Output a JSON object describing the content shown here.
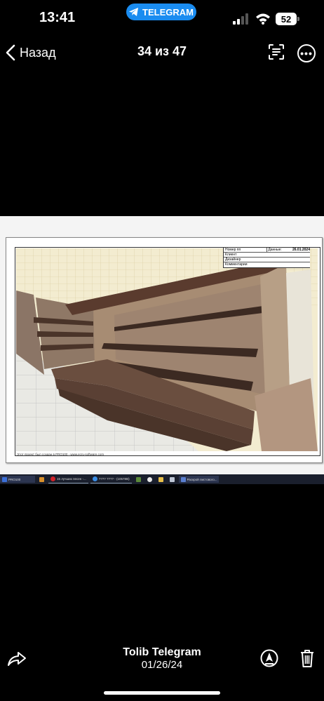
{
  "status_bar": {
    "time": "13:41",
    "telegram_label": "TELEGRAM",
    "battery": "52"
  },
  "nav": {
    "back_label": "Назад",
    "counter": "34 из 47"
  },
  "photo": {
    "title_block": {
      "number_label": "Номер пп",
      "date_label": "Данные:",
      "date_value": "26.01.2024",
      "client_label": "Клиент",
      "designer_label": "Дизайнер",
      "comments_label": "Комментарии"
    },
    "footer_note": "Этот проект был создан в PRO100 - www.ecru-software.com",
    "taskbar": [
      {
        "label": "PRO100",
        "icon": "pro100-icon"
      },
      {
        "label": "",
        "icon": "pdf-icon"
      },
      {
        "label": "15 лучших песен -...",
        "icon": "opera-icon"
      },
      {
        "label": "???? ???? - (10578B)",
        "icon": "chrome-icon"
      },
      {
        "label": "",
        "icon": "minecraft-icon"
      },
      {
        "label": "",
        "icon": "settings-icon"
      },
      {
        "label": "",
        "icon": "folder-icon"
      },
      {
        "label": "",
        "icon": "app-icon"
      },
      {
        "label": "Раскрой листового...",
        "icon": "app-window-icon"
      }
    ]
  },
  "footer": {
    "sender": "Tolib Telegram",
    "date": "01/26/24"
  },
  "colors": {
    "accent": "#1a8cf0",
    "background": "#000000"
  }
}
